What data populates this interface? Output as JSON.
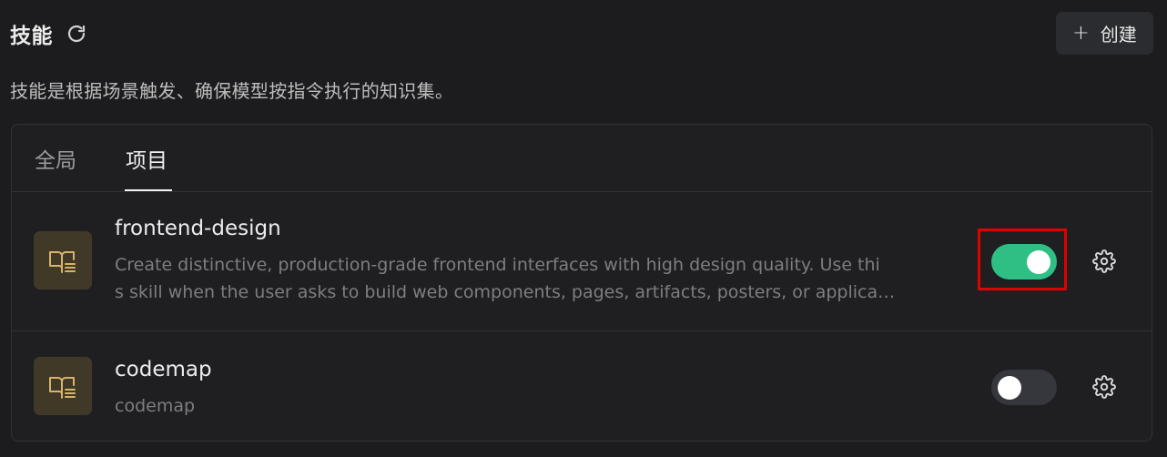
{
  "header": {
    "title": "技能",
    "refresh_icon": "refresh-icon",
    "create_label": "创建",
    "create_icon": "plus-icon"
  },
  "subtitle": "技能是根据场景触发、确保模型按指令执行的知识集。",
  "tabs": [
    {
      "label": "全局",
      "active": false
    },
    {
      "label": "项目",
      "active": true
    }
  ],
  "skills": [
    {
      "name": "frontend-design",
      "description": "Create distinctive, production-grade frontend interfaces with high design quality. Use thi",
      "description_line2": "s skill when the user asks to build web components, pages, artifacts, posters, or applica…",
      "enabled": true,
      "icon": "book-icon",
      "settings_icon": "gear-icon"
    },
    {
      "name": "codemap",
      "description": "codemap",
      "enabled": false,
      "icon": "book-icon",
      "settings_icon": "gear-icon"
    }
  ],
  "colors": {
    "background": "#1c1c1e",
    "toggle_on": "#2fbf85",
    "toggle_off": "#36373c",
    "icon_tile": "#403928",
    "icon_accent": "#d9b36a",
    "highlight": "#e00000"
  }
}
